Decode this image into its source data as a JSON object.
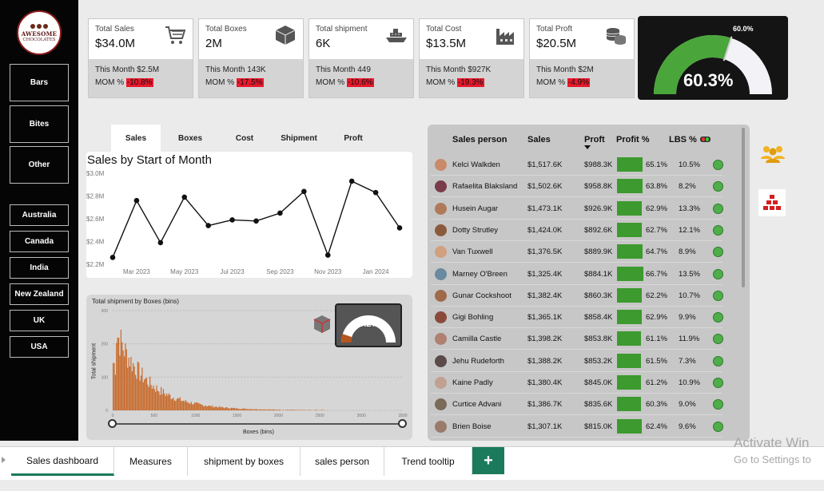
{
  "logo": {
    "line1": "AWESOME",
    "line2": "CHOCOLATES"
  },
  "nav": {
    "categories": [
      "Bars",
      "Bites",
      "Other"
    ],
    "countries": [
      "Australia",
      "Canada",
      "India",
      "New Zealand",
      "UK",
      "USA"
    ]
  },
  "kpis": [
    {
      "title": "Total Sales",
      "value": "$34.0M",
      "this_month": "This Month $2.5M",
      "mom_label": "MOM %",
      "mom": "-10.8%",
      "icon": "cart-icon"
    },
    {
      "title": "Total Boxes",
      "value": "2M",
      "this_month": "This Month 143K",
      "mom_label": "MOM %",
      "mom": "-17.5%",
      "icon": "box-icon"
    },
    {
      "title": "Total shipment",
      "value": "6K",
      "this_month": "This Month 449",
      "mom_label": "MOM %",
      "mom": "-10.6%",
      "icon": "ship-icon"
    },
    {
      "title": "Total Cost",
      "value": "$13.5M",
      "this_month": "This Month $927K",
      "mom_label": "MOM %",
      "mom": "-19.3%",
      "icon": "factory-icon"
    },
    {
      "title": "Total Proft",
      "value": "$20.5M",
      "this_month": "This Month $2M",
      "mom_label": "MOM %",
      "mom": "-4.9%",
      "icon": "coins-icon"
    }
  ],
  "gauge_main": {
    "value_label": "60.3%",
    "target_label": "60.0%",
    "value": 60.3,
    "target": 60.0,
    "fill_color": "#4aa63a"
  },
  "tabs": [
    "Sales",
    "Boxes",
    "Cost",
    "Shipment",
    "Proft"
  ],
  "active_tab": "Sales",
  "line_chart": {
    "title": "Sales by Start of Month",
    "chart_data": {
      "type": "line",
      "x": [
        "Feb 2023",
        "Mar 2023",
        "Apr 2023",
        "May 2023",
        "Jun 2023",
        "Jul 2023",
        "Aug 2023",
        "Sep 2023",
        "Oct 2023",
        "Nov 2023",
        "Dec 2023",
        "Jan 2024",
        "Feb 2024"
      ],
      "y": [
        2.26,
        2.76,
        2.39,
        2.79,
        2.54,
        2.59,
        2.58,
        2.65,
        2.84,
        2.28,
        2.93,
        2.83,
        2.52
      ],
      "xticks": [
        "Mar 2023",
        "May 2023",
        "Jul 2023",
        "Sep 2023",
        "Nov 2023",
        "Jan 2024"
      ],
      "yticks": [
        "$3.0M",
        "$2.8M",
        "$2.6M",
        "$2.4M",
        "$2.2M"
      ],
      "ylim": [
        2.2,
        3.0
      ]
    }
  },
  "histogram": {
    "title": "Total shipment by Boxes (bins)",
    "xlabel": "Boxes (bins)",
    "ylabel": "Total shipment",
    "xticks": [
      "0",
      "500",
      "1000",
      "1500",
      "2000",
      "2500",
      "3000",
      "3500"
    ],
    "yticks": [
      "300",
      "200",
      "100",
      "0"
    ],
    "bar_color": "#c8692a",
    "gauge_label": "10.2%",
    "gauge_value": 10.2
  },
  "table": {
    "headers": {
      "person": "Sales person",
      "sales": "Sales",
      "proft": "Proft",
      "profit_pct": "Profit %",
      "lbs": "LBS %"
    },
    "rows": [
      {
        "name": "Kelci Walkden",
        "sales": "$1,517.6K",
        "proft": "$988.3K",
        "pct": "65.1%",
        "lbs": "10.5%",
        "fill": 0.98
      },
      {
        "name": "Rafaelita Blaksland",
        "sales": "$1,502.6K",
        "proft": "$958.8K",
        "pct": "63.8%",
        "lbs": "8.2%",
        "fill": 0.96
      },
      {
        "name": "Husein Augar",
        "sales": "$1,473.1K",
        "proft": "$926.9K",
        "pct": "62.9%",
        "lbs": "13.3%",
        "fill": 0.94
      },
      {
        "name": "Dotty Strutley",
        "sales": "$1,424.0K",
        "proft": "$892.6K",
        "pct": "62.7%",
        "lbs": "12.1%",
        "fill": 0.94
      },
      {
        "name": "Van Tuxwell",
        "sales": "$1,376.5K",
        "proft": "$889.9K",
        "pct": "64.7%",
        "lbs": "8.9%",
        "fill": 0.97
      },
      {
        "name": "Marney O'Breen",
        "sales": "$1,325.4K",
        "proft": "$884.1K",
        "pct": "66.7%",
        "lbs": "13.5%",
        "fill": 1.0
      },
      {
        "name": "Gunar Cockshoot",
        "sales": "$1,382.4K",
        "proft": "$860.3K",
        "pct": "62.2%",
        "lbs": "10.7%",
        "fill": 0.93
      },
      {
        "name": "Gigi Bohling",
        "sales": "$1,365.1K",
        "proft": "$858.4K",
        "pct": "62.9%",
        "lbs": "9.9%",
        "fill": 0.94
      },
      {
        "name": "Camilla Castle",
        "sales": "$1,398.2K",
        "proft": "$853.8K",
        "pct": "61.1%",
        "lbs": "11.9%",
        "fill": 0.92
      },
      {
        "name": "Jehu Rudeforth",
        "sales": "$1,388.2K",
        "proft": "$853.2K",
        "pct": "61.5%",
        "lbs": "7.3%",
        "fill": 0.92
      },
      {
        "name": "Kaine Padly",
        "sales": "$1,380.4K",
        "proft": "$845.0K",
        "pct": "61.2%",
        "lbs": "10.9%",
        "fill": 0.92
      },
      {
        "name": "Curtice Advani",
        "sales": "$1,386.7K",
        "proft": "$835.6K",
        "pct": "60.3%",
        "lbs": "9.0%",
        "fill": 0.9
      },
      {
        "name": "Brien Boise",
        "sales": "$1,307.1K",
        "proft": "$815.0K",
        "pct": "62.4%",
        "lbs": "9.6%",
        "fill": 0.94
      }
    ]
  },
  "side_icons": [
    "people-icon",
    "pyramid-icon"
  ],
  "bottom_tabs": [
    "Sales dashboard",
    "Measures",
    "shipment by boxes",
    "sales person",
    "Trend tooltip"
  ],
  "add_tab_label": "+",
  "watermark": {
    "line1": "Activate Win",
    "line2": "Go to Settings to"
  }
}
